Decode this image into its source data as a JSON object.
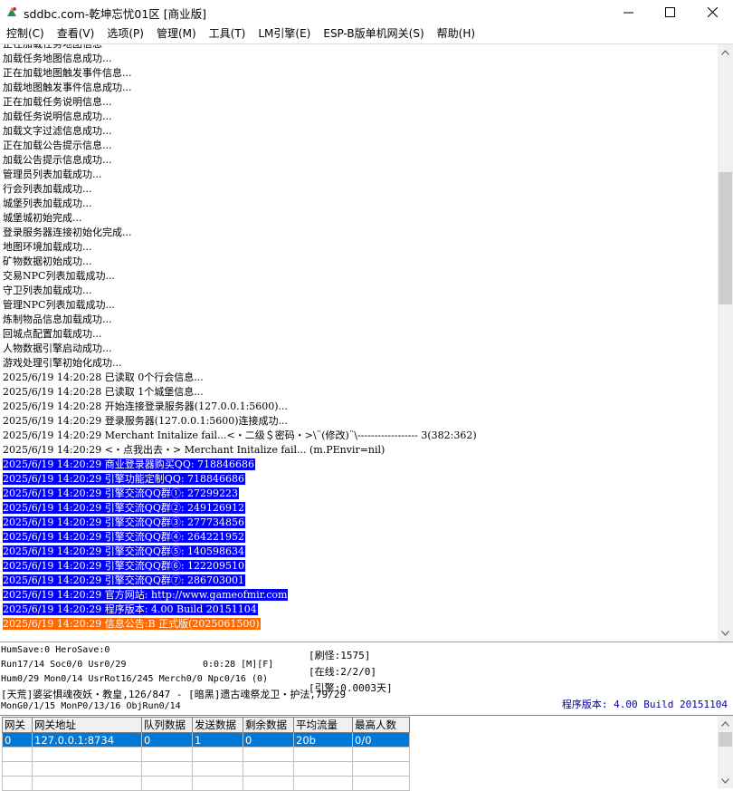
{
  "window": {
    "title": "sddbc.com-乾坤忘忧01区 [商业版]"
  },
  "menu": [
    "控制(C)",
    "查看(V)",
    "选项(P)",
    "管理(M)",
    "工具(T)",
    "LM引擎(E)",
    "ESP-B版单机网关(S)",
    "帮助(H)"
  ],
  "log": [
    {
      "text": "正在加载任务地图信息",
      "hl": ""
    },
    {
      "text": "加载任务地图信息成功...",
      "hl": ""
    },
    {
      "text": "正在加载地图触发事件信息...",
      "hl": ""
    },
    {
      "text": "加载地图触发事件信息成功...",
      "hl": ""
    },
    {
      "text": "正在加载任务说明信息...",
      "hl": ""
    },
    {
      "text": "加载任务说明信息成功...",
      "hl": ""
    },
    {
      "text": "加载文字过滤信息成功...",
      "hl": ""
    },
    {
      "text": "正在加载公告提示信息...",
      "hl": ""
    },
    {
      "text": "加载公告提示信息成功...",
      "hl": ""
    },
    {
      "text": "管理员列表加载成功...",
      "hl": ""
    },
    {
      "text": "行会列表加载成功...",
      "hl": ""
    },
    {
      "text": "城堡列表加载成功...",
      "hl": ""
    },
    {
      "text": "城堡城初始完成...",
      "hl": ""
    },
    {
      "text": "登录服务器连接初始化完成...",
      "hl": ""
    },
    {
      "text": "地图环境加载成功...",
      "hl": ""
    },
    {
      "text": "矿物数据初始成功...",
      "hl": ""
    },
    {
      "text": "交易NPC列表加载成功...",
      "hl": ""
    },
    {
      "text": "守卫列表加载成功...",
      "hl": ""
    },
    {
      "text": "管理NPC列表加载成功...",
      "hl": ""
    },
    {
      "text": "炼制物品信息加载成功...",
      "hl": ""
    },
    {
      "text": "回城点配置加载成功...",
      "hl": ""
    },
    {
      "text": "人物数据引擎启动成功...",
      "hl": ""
    },
    {
      "text": "游戏处理引擎初始化成功...",
      "hl": ""
    },
    {
      "text": "2025/6/19 14:20:28 已读取 0个行会信息...",
      "hl": ""
    },
    {
      "text": "2025/6/19 14:20:28 已读取 1个城堡信息...",
      "hl": ""
    },
    {
      "text": "2025/6/19 14:20:28 开始连接登录服务器(127.0.0.1:5600)...",
      "hl": ""
    },
    {
      "text": "2025/6/19 14:20:29 登录服务器(127.0.0.1:5600)连接成功...",
      "hl": ""
    },
    {
      "text": "2025/6/19 14:20:29 Merchant Initalize fail...<・二级＄密码・>\\¨(修改)¨\\------------------ 3(382:362)",
      "hl": ""
    },
    {
      "text": "2025/6/19 14:20:29 <・点我出去・> Merchant Initalize fail... (m.PEnvir=nil)",
      "hl": ""
    },
    {
      "text": "2025/6/19 14:20:29 商业登录器购买QQ: 718846686",
      "hl": "blue"
    },
    {
      "text": "2025/6/19 14:20:29 引擎功能定制QQ: 718846686",
      "hl": "blue"
    },
    {
      "text": "2025/6/19 14:20:29 引擎交流QQ群①: 27299223",
      "hl": "blue"
    },
    {
      "text": "2025/6/19 14:20:29 引擎交流QQ群②: 249126912",
      "hl": "blue"
    },
    {
      "text": "2025/6/19 14:20:29 引擎交流QQ群③: 277734856",
      "hl": "blue"
    },
    {
      "text": "2025/6/19 14:20:29 引擎交流QQ群④: 264221952",
      "hl": "blue"
    },
    {
      "text": "2025/6/19 14:20:29 引擎交流QQ群⑤: 140598634",
      "hl": "blue"
    },
    {
      "text": "2025/6/19 14:20:29 引擎交流QQ群⑥: 122209510",
      "hl": "blue"
    },
    {
      "text": "2025/6/19 14:20:29 引擎交流QQ群⑦: 286703001",
      "hl": "blue"
    },
    {
      "text": "2025/6/19 14:20:29 官方网站: http://www.gameofmir.com",
      "hl": "blue"
    },
    {
      "text": "2025/6/19 14:20:29 程序版本: 4.00 Build 20151104",
      "hl": "blue"
    },
    {
      "text": "2025/6/19 14:20:29 信息公告:B 正式版(2025061500)",
      "hl": "orange"
    }
  ],
  "status": {
    "line1": "HumSave:0 HeroSave:0",
    "line2a": "Run17/14 Soc0/0 Usr0/29",
    "line2b": "0:0:28 [M][F]",
    "line3": "Hum0/29 Mon0/14 UsrRot16/245 Merch0/0 Npc0/16 (0)",
    "line4": "[天荒]婆娑惧魂夜妖・教皇,126/847 - [暗黑]遗古魂祭龙卫・护法,79/29",
    "line5": "MonG0/1/15 MonP0/13/16 ObjRun0/14",
    "refresh": "[刷怪:1575]",
    "online": "[在线:2/2/0]",
    "engine": "[引擎:0.0003天]",
    "version": "程序版本: 4.00 Build 20151104"
  },
  "gateway_table": {
    "headers": [
      "网关",
      "网关地址",
      "队列数据",
      "发送数据",
      "剩余数据",
      "平均流量",
      "最高人数"
    ],
    "rows": [
      [
        "0",
        "127.0.0.1:8734",
        "0",
        "1",
        "0",
        "20b",
        "0/0"
      ]
    ]
  }
}
